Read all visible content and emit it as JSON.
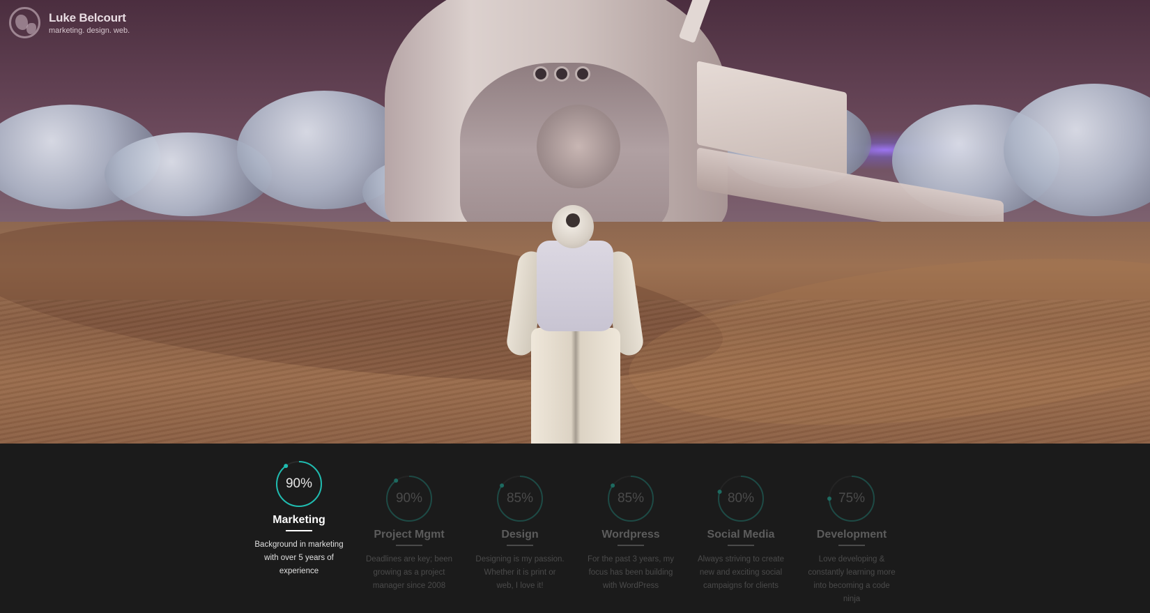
{
  "brand": {
    "name": "Luke Belcourt",
    "tagline": "marketing. design. web.",
    "logo_icon": "globe-icon"
  },
  "colors": {
    "accent": "#1fbcb0",
    "panel_bg": "#1b1b1b"
  },
  "skills": [
    {
      "percent_label": "90%",
      "percent": 90,
      "title": "Marketing",
      "description": "Background in marketing with over 5 years of experience",
      "active": true
    },
    {
      "percent_label": "90%",
      "percent": 90,
      "title": "Project Mgmt",
      "description": "Deadlines are key; been growing as a project manager since 2008",
      "active": false
    },
    {
      "percent_label": "85%",
      "percent": 85,
      "title": "Design",
      "description": "Designing is my passion. Whether it is print or web, I love it!",
      "active": false
    },
    {
      "percent_label": "85%",
      "percent": 85,
      "title": "Wordpress",
      "description": "For the past 3 years, my focus has been building with WordPress",
      "active": false
    },
    {
      "percent_label": "80%",
      "percent": 80,
      "title": "Social Media",
      "description": "Always striving to create new and exciting social campaigns for clients",
      "active": false
    },
    {
      "percent_label": "75%",
      "percent": 75,
      "title": "Development",
      "description": "Love developing & constantly learning more into becoming a code ninja",
      "active": false
    }
  ]
}
